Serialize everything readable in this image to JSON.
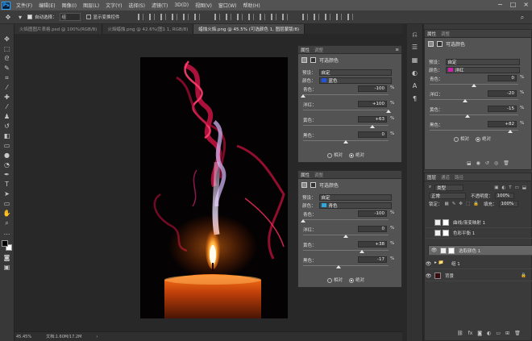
{
  "menu": {
    "logo": "Ps",
    "items": [
      "文件(F)",
      "编辑(E)",
      "图像(I)",
      "图层(L)",
      "文字(Y)",
      "选择(S)",
      "滤镜(T)",
      "3D(D)",
      "视图(V)",
      "窗口(W)",
      "帮助(H)"
    ],
    "window_buttons": [
      "−",
      "□",
      "×"
    ]
  },
  "options": {
    "auto_select_label": "自动选择：",
    "auto_select_value": "组",
    "show_transform": "显示变换控件"
  },
  "tabs": [
    {
      "label": "火焰图图片表格.psd @ 100%(RGB/8)",
      "active": false
    },
    {
      "label": "火焰蜡烛.png @ 42.6%(图1 1, RGB/8)",
      "active": false
    },
    {
      "label": "蜡烛火焰.png @ 45.5% (可选颜色 1, 图层蒙版/8)",
      "active": true
    }
  ],
  "status": {
    "zoom": "45.45%",
    "doc": "文档:1.60M/17.2M"
  },
  "panel1": {
    "tab_props": "属性",
    "tab_adj": "调整",
    "title": "可选颜色",
    "preset_label": "预设：",
    "preset_value": "自定",
    "color_label": "颜色：",
    "color_value": "蓝色",
    "color_swatch": "#2255dd",
    "sliders": [
      {
        "label": "青色：",
        "value": "-100",
        "pos": 0.0
      },
      {
        "label": "洋红：",
        "value": "+100",
        "pos": 1.0
      },
      {
        "label": "黄色：",
        "value": "+63",
        "pos": 0.815
      },
      {
        "label": "黑色：",
        "value": "0",
        "pos": 0.5
      }
    ],
    "radio_relative": "相对",
    "radio_absolute": "绝对"
  },
  "panel2": {
    "tab_props": "属性",
    "tab_adj": "调整",
    "title": "可选颜色",
    "preset_label": "预设：",
    "preset_value": "自定",
    "color_label": "颜色：",
    "color_value": "青色",
    "color_swatch": "#2aa8e0",
    "sliders": [
      {
        "label": "青色：",
        "value": "-100",
        "pos": 0.0
      },
      {
        "label": "洋红：",
        "value": "0",
        "pos": 0.5
      },
      {
        "label": "黄色：",
        "value": "+38",
        "pos": 0.69
      },
      {
        "label": "黑色：",
        "value": "-17",
        "pos": 0.415
      }
    ],
    "radio_relative": "相对",
    "radio_absolute": "绝对"
  },
  "panel3": {
    "tab_props": "属性",
    "tab_adj": "调整",
    "title": "可选颜色",
    "preset_label": "预设：",
    "preset_value": "自定",
    "color_label": "颜色：",
    "color_value": "洋红",
    "color_swatch": "#cc22aa",
    "sliders": [
      {
        "label": "青色：",
        "value": "0",
        "pos": 0.5
      },
      {
        "label": "洋红：",
        "value": "-20",
        "pos": 0.4
      },
      {
        "label": "黄色：",
        "value": "-15",
        "pos": 0.425
      },
      {
        "label": "黑色：",
        "value": "+82",
        "pos": 0.91
      }
    ],
    "radio_relative": "相对",
    "radio_absolute": "绝对"
  },
  "layers": {
    "tabs": [
      "图层",
      "通道",
      "路径"
    ],
    "kind": "类型",
    "blend": "正常",
    "opacity_label": "不透明度：",
    "opacity": "100%",
    "lock_label": "锁定：",
    "fill_label": "填充：",
    "fill": "100%",
    "items": [
      {
        "name": "曲线/渐变映射 1",
        "visible": false,
        "selected": false
      },
      {
        "name": "色彩平衡 1",
        "visible": false,
        "selected": false
      },
      {
        "name": "选取颜色 1",
        "visible": true,
        "selected": true
      },
      {
        "name": "组 1",
        "visible": true,
        "selected": false
      },
      {
        "name": "背景",
        "visible": true,
        "selected": false
      }
    ]
  }
}
